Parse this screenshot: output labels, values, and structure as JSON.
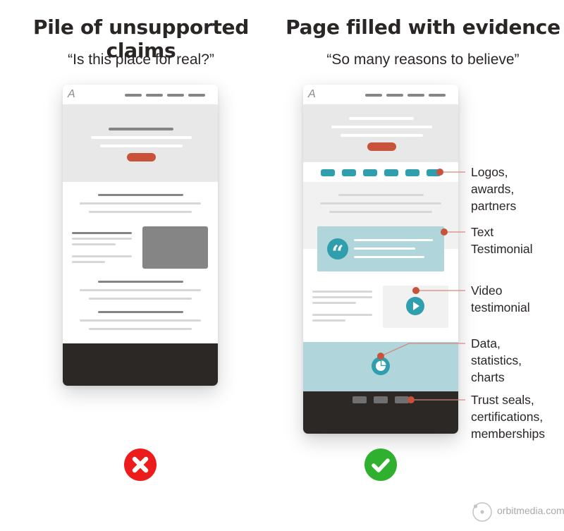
{
  "left": {
    "title": "Pile of unsupported claims",
    "subtitle": "“Is this place for real?”",
    "logo_glyph": "A",
    "verdict_icon": "x-icon",
    "verdict_color": "#ed1c1c"
  },
  "right": {
    "title": "Page filled with evidence",
    "subtitle": "“So many reasons to believe”",
    "logo_glyph": "A",
    "verdict_icon": "checkmark-icon",
    "verdict_color": "#2fb02f",
    "quote_glyph": "“",
    "callouts": [
      {
        "id": "logos",
        "lines": [
          "Logos,",
          "awards,",
          "partners"
        ]
      },
      {
        "id": "text-testimonial",
        "lines": [
          "Text",
          "Testimonial"
        ]
      },
      {
        "id": "video-testimonial",
        "lines": [
          "Video",
          "testimonial"
        ]
      },
      {
        "id": "data",
        "lines": [
          "Data,",
          "statistics,",
          "charts"
        ]
      },
      {
        "id": "trust-seals",
        "lines": [
          "Trust seals,",
          "certifications,",
          "memberships"
        ]
      }
    ]
  },
  "colors": {
    "accent": "#c9533a",
    "teal": "#2f9fae",
    "light_teal": "#b0d6dc",
    "footer_dark": "#2c2826",
    "hero_gray": "#e8e8e8"
  },
  "brand": {
    "text": "orbitmedia.com"
  }
}
